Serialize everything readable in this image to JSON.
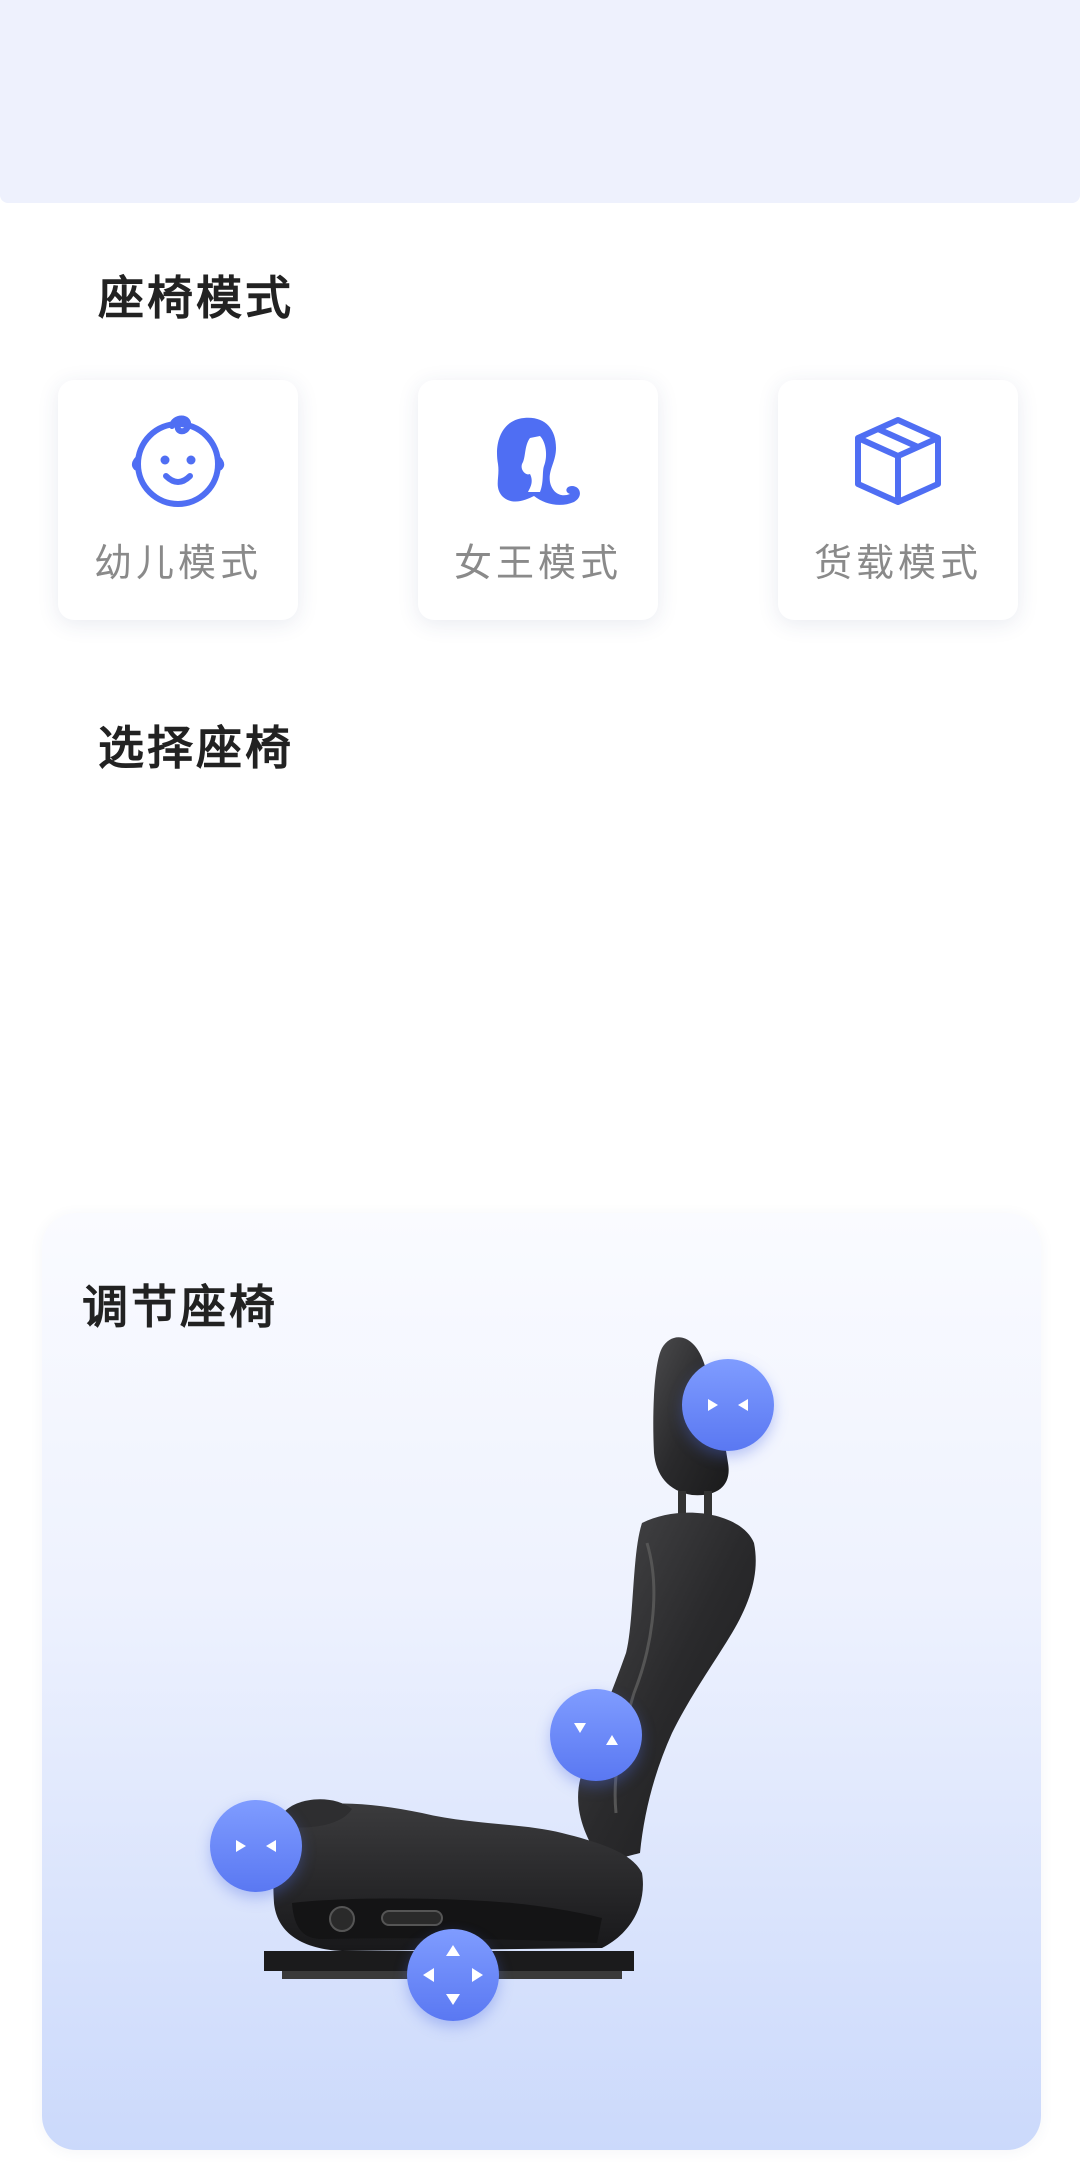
{
  "seat_modes": {
    "title": "座椅模式",
    "items": [
      {
        "label": "幼儿模式",
        "icon": "baby-face-icon"
      },
      {
        "label": "女王模式",
        "icon": "queen-hair-icon"
      },
      {
        "label": "货载模式",
        "icon": "cargo-box-icon"
      }
    ]
  },
  "select_seat": {
    "title": "选择座椅"
  },
  "adjust": {
    "title": "调节座椅",
    "controls": [
      {
        "name": "headrest-adjust",
        "icon": "left-right-arrows-icon"
      },
      {
        "name": "backrest-recline",
        "icon": "recline-arrows-icon"
      },
      {
        "name": "cushion-tilt",
        "icon": "left-right-arrows-icon"
      },
      {
        "name": "seat-position",
        "icon": "four-way-arrows-icon"
      }
    ]
  },
  "colors": {
    "accent": "#4f6ef3",
    "card_gradient_end": "#cbd9fb",
    "top_band": "#eef1fd"
  }
}
